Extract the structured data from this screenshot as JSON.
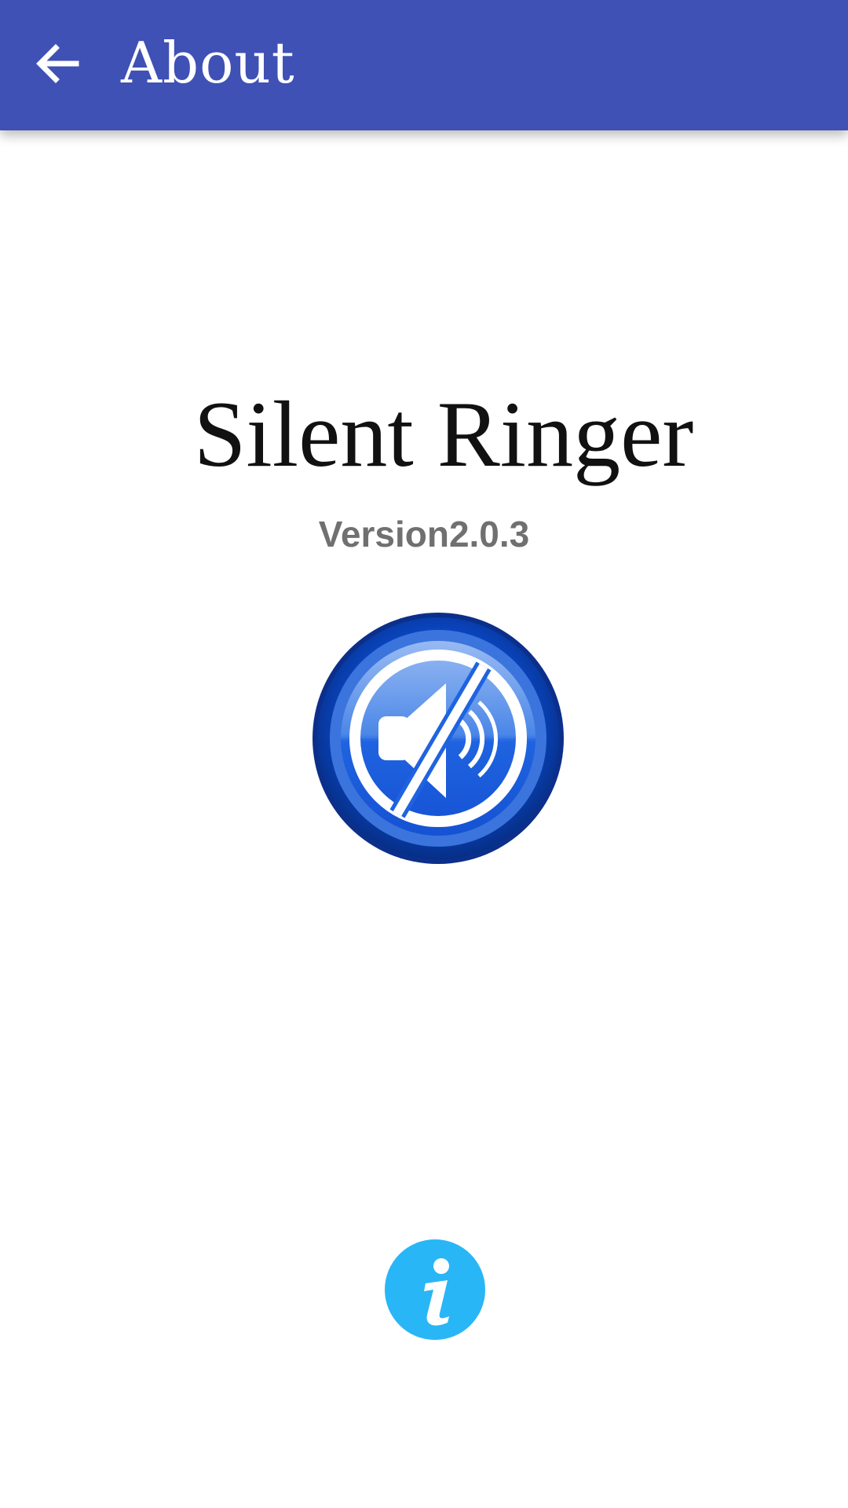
{
  "app_bar": {
    "title": "About",
    "back_icon": "arrow-left-icon",
    "background_color": "#3f51b5"
  },
  "main": {
    "app_name": "Silent Ringer",
    "version_text": "Version2.0.3",
    "logo_icon": "speaker-muted-icon",
    "info_icon": "info-icon",
    "info_color": "#29b6f6"
  }
}
